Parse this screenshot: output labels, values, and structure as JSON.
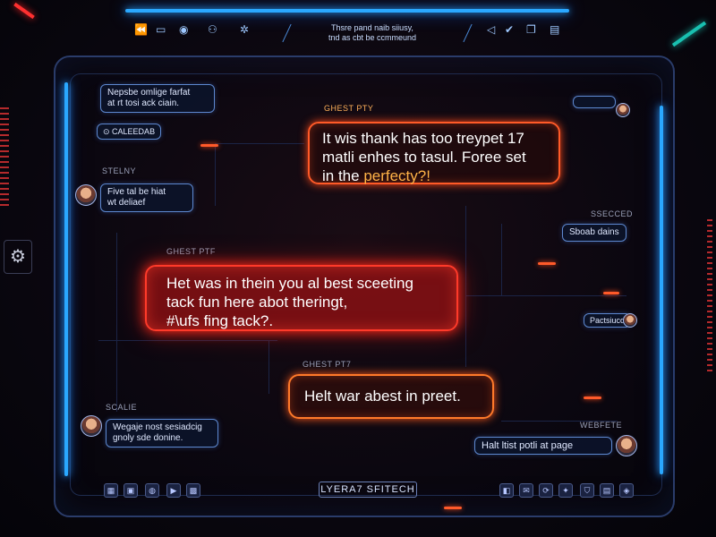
{
  "toolbar": {
    "title_line1": "Thsre pand naib siiusy,",
    "title_line2": "tnd as cbt be ccmmeund",
    "left_icons": [
      "rewind-icon",
      "folder-icon",
      "record-icon",
      "users-icon",
      "settings-icon"
    ],
    "right_icons": [
      "send-icon",
      "check-icon",
      "copy-icon",
      "menu-icon"
    ]
  },
  "messages": {
    "left_info": {
      "line1": "Nepsbe omlige farfat",
      "line2": "at rt tosi ack ciain."
    },
    "tag_a": "CALEEDAB",
    "label_stelny": "STELNY",
    "stelny_msg": {
      "line1": "Five tal be hiat",
      "line2": "wt deliaef"
    },
    "ghest_top_label": "GHEST PTY",
    "bubble1": {
      "line1": "It wis thank has too treypet 17",
      "line2": "matli enhes to tasul. Foree set",
      "line3_a": "in the ",
      "line3_b": "perfecty?!"
    },
    "right_top_label": "SSECCED",
    "right_pill_a": "Sboab dains",
    "ghest_mid_label": "GHEST PTF",
    "bubble2": {
      "line1": "Het was in thein you al best sceeting",
      "line2": "tack fun here abot theringt,",
      "line3": "#\\ufs fing tack?."
    },
    "right_pill_b": "Pactsiucd",
    "ghest_low_label": "GHEST PT7",
    "bubble3": "Helt war abest in preet.",
    "label_scaline": "SCALIE",
    "scaline_msg": {
      "line1": "Wegaje nost sesiadcig",
      "line2": "gnoly sde donine."
    },
    "label_webfete": "WEBFETE",
    "webfete_msg": "Halt ltist potli at page"
  },
  "bottom": {
    "brand": "LYERA7 SFITECH",
    "left_icons": [
      "grid-icon",
      "image-icon",
      "globe-icon",
      "video-icon",
      "qr-icon"
    ],
    "right_icons": [
      "app-icon",
      "mail-icon",
      "share-icon",
      "twitter-icon",
      "shield-icon",
      "doc-icon",
      "tag-icon",
      "grid2-icon"
    ]
  },
  "colors": {
    "accent_blue": "#2aa8ff",
    "accent_red": "#ff3a2a",
    "accent_orange": "#ff7a2a"
  }
}
